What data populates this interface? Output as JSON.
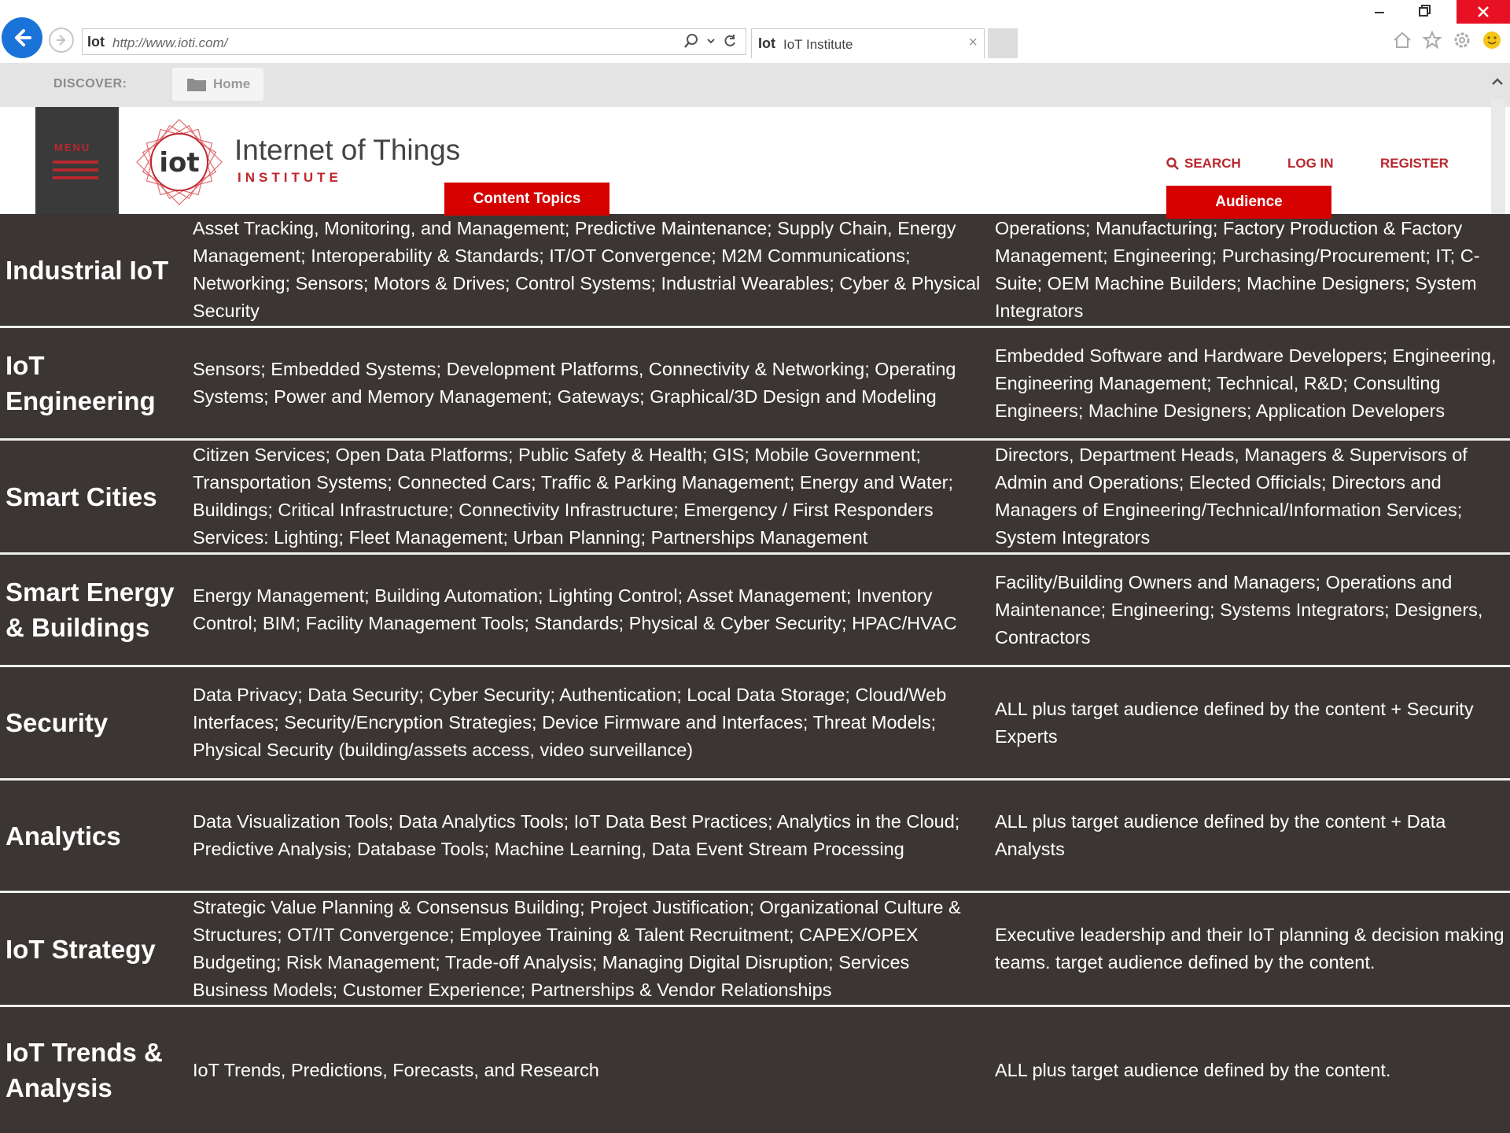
{
  "browser": {
    "address_favicon": "Iot",
    "url": "http://www.ioti.com/",
    "tab_favicon": "Iot",
    "tab_title": "IoT Institute",
    "tab_close": "×"
  },
  "favorites_bar": {
    "discover_label": "DISCOVER:",
    "home_label": "Home"
  },
  "site_header": {
    "menu_label": "MENU",
    "logo_mark_text": "iot",
    "logo_line1": "Internet of Things",
    "logo_line2": "INSTITUTE",
    "search_label": "SEARCH",
    "login_label": "LOG IN",
    "register_label": "REGISTER"
  },
  "column_labels": {
    "content_topics": "Content Topics",
    "audience": "Audience"
  },
  "colors": {
    "accent_red": "#d50000",
    "table_bg": "#3b3634",
    "brand_red": "#b8282e"
  },
  "rows": [
    {
      "category": "Industrial IoT",
      "topics": "Asset Tracking, Monitoring, and Management; Predictive Maintenance; Supply Chain, Energy Management; Interoperability & Standards; IT/OT Convergence; M2M Communications; Networking; Sensors; Motors & Drives; Control Systems; Industrial Wearables; Cyber & Physical Security",
      "audience": "Operations; Manufacturing; Factory Production & Factory Management; Engineering; Purchasing/Procurement; IT; C-Suite;  OEM Machine Builders; Machine Designers; System Integrators"
    },
    {
      "category": "IoT Engineering",
      "topics": "Sensors; Embedded Systems; Development Platforms, Connectivity & Networking; Operating Systems; Power and Memory Management; Gateways; Graphical/3D Design and Modeling",
      "audience": "Embedded Software and Hardware Developers; Engineering, Engineering Management; Technical, R&D; Consulting Engineers; Machine Designers; Application Developers"
    },
    {
      "category": "Smart Cities",
      "topics": "Citizen Services; Open Data Platforms; Public Safety & Health; GIS; Mobile Government; Transportation Systems; Connected Cars; Traffic & Parking Management; Energy and Water; Buildings; Critical Infrastructure; Connectivity Infrastructure; Emergency / First Responders Services: Lighting; Fleet Management; Urban Planning; Partnerships Management",
      "audience": "Directors, Department Heads, Managers & Supervisors of Admin and Operations; Elected Officials; Directors and Managers of Engineering/Technical/Information Services; System Integrators"
    },
    {
      "category": "Smart Energy & Buildings",
      "topics": "Energy Management; Building Automation;  Lighting Control; Asset Management; Inventory Control; BIM; Facility Management Tools; Standards; Physical & Cyber Security; HPAC/HVAC",
      "audience": "Facility/Building Owners and Managers; Operations and Maintenance; Engineering; Systems Integrators; Designers, Contractors"
    },
    {
      "category": "Security",
      "topics": "Data Privacy; Data Security; Cyber Security; Authentication; Local Data Storage; Cloud/Web Interfaces; Security/Encryption Strategies; Device Firmware and Interfaces; Threat Models; Physical Security (building/assets access, video surveillance)",
      "audience": "ALL plus target audience defined by the content + Security Experts"
    },
    {
      "category": "Analytics",
      "topics": "Data Visualization Tools; Data Analytics Tools; IoT Data Best Practices; Analytics in the Cloud; Predictive Analysis; Database Tools; Machine Learning, Data Event Stream Processing",
      "audience": "ALL plus target audience defined by the content + Data Analysts"
    },
    {
      "category": "IoT Strategy",
      "topics": "Strategic Value Planning & Consensus Building; Project Justification; Organizational Culture & Structures; OT/IT Convergence; Employee Training & Talent Recruitment; CAPEX/OPEX Budgeting; Risk Management; Trade-off Analysis; Managing Digital Disruption; Services Business Models; Customer Experience; Partnerships & Vendor Relationships",
      "audience": "Executive leadership and their IoT planning & decision making teams. target audience defined by the content."
    },
    {
      "category": "IoT Trends & Analysis",
      "topics": "IoT Trends, Predictions, Forecasts, and Research",
      "audience": "ALL plus target audience defined by the content."
    }
  ]
}
